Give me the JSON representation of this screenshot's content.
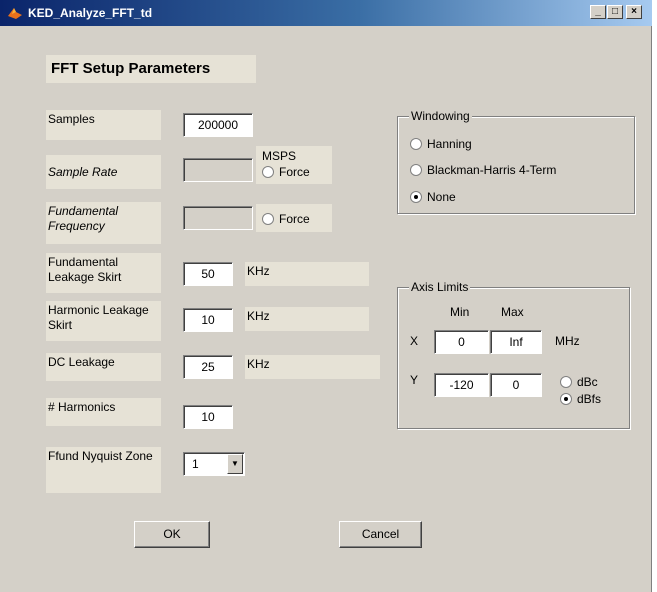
{
  "window": {
    "title": "KED_Analyze_FFT_td",
    "minimize": "_",
    "maximize": "□",
    "close": "×"
  },
  "heading": "FFT Setup Parameters",
  "fields": {
    "samples": {
      "label": "Samples",
      "value": "200000"
    },
    "sample_rate": {
      "label": "Sample Rate",
      "value": "",
      "unit": "MSPS",
      "force": "Force"
    },
    "fundamental_frequency": {
      "label": "Fundamental Frequency",
      "value": "",
      "force": "Force"
    },
    "fundamental_leakage": {
      "label": "Fundamental Leakage Skirt",
      "value": "50",
      "unit": "KHz"
    },
    "harmonic_leakage": {
      "label": "Harmonic Leakage Skirt",
      "value": "10",
      "unit": "KHz"
    },
    "dc_leakage": {
      "label": "DC Leakage",
      "value": "25",
      "unit": "KHz"
    },
    "harmonics": {
      "label": "# Harmonics",
      "value": "10"
    },
    "nyquist_zone": {
      "label": "Ffund Nyquist Zone",
      "value": "1"
    }
  },
  "windowing": {
    "title": "Windowing",
    "options": [
      "Hanning",
      "Blackman-Harris 4-Term",
      "None"
    ],
    "selected": "None"
  },
  "axis_limits": {
    "title": "Axis Limits",
    "min_label": "Min",
    "max_label": "Max",
    "x_label": "X",
    "x_min": "0",
    "x_max": "Inf",
    "x_unit": "MHz",
    "y_label": "Y",
    "y_min": "-120",
    "y_max": "0",
    "y_units": [
      "dBc",
      "dBfs"
    ],
    "y_unit_selected": "dBfs"
  },
  "buttons": {
    "ok": "OK",
    "cancel": "Cancel"
  }
}
